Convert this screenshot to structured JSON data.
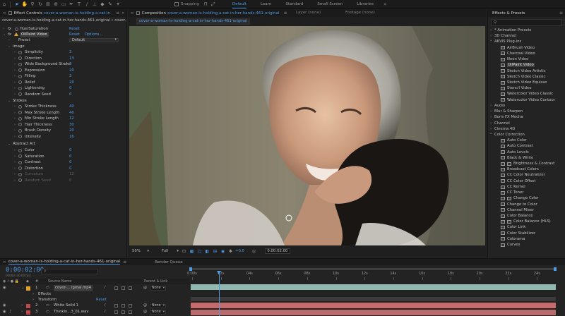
{
  "toolbar": {
    "snapping": "Snapping",
    "workspaces": [
      "Default",
      "Learn",
      "Standard",
      "Small Screen",
      "Libraries"
    ],
    "active_workspace": "Default"
  },
  "effect_controls": {
    "tab_label": "Effect Controls",
    "tab_file": "cover-a-woman-is-holding-a-cat-in-",
    "source": "cover-a-woman-is-holding-a-cat-in-her-hands-461-original",
    "source_b": "cover-a-woman-is-holdi",
    "effects": [
      {
        "name": "Hue/Saturation",
        "reset": "Reset"
      },
      {
        "name": "OilPaint Video",
        "reset": "Reset",
        "options": "Options..."
      }
    ],
    "preset_label": "Preset",
    "preset_value": "Default",
    "groups": {
      "image": "Image",
      "strokes": "Strokes",
      "abstract": "Abstract Art"
    },
    "image_params": [
      {
        "label": "Simplicity",
        "value": "3"
      },
      {
        "label": "Direction",
        "value": "13"
      },
      {
        "label": "Wide Background Stroke",
        "value": "3"
      },
      {
        "label": "Expression",
        "value": "20"
      },
      {
        "label": "Filling",
        "value": "3"
      },
      {
        "label": "Relief",
        "value": "20"
      },
      {
        "label": "Lightening",
        "value": "0"
      },
      {
        "label": "Random Seed",
        "value": "0"
      }
    ],
    "stroke_params": [
      {
        "label": "Stroke Thickness",
        "value": "40"
      },
      {
        "label": "Max Stroke Length",
        "value": "40"
      },
      {
        "label": "Min Stroke Length",
        "value": "12"
      },
      {
        "label": "Hair Thickness",
        "value": "30"
      },
      {
        "label": "Brush Density",
        "value": "20"
      },
      {
        "label": "Intensity",
        "value": "16"
      }
    ],
    "abstract_params": [
      {
        "label": "Color",
        "value": "0"
      },
      {
        "label": "Saturation",
        "value": "0"
      },
      {
        "label": "Contrast",
        "value": "0"
      },
      {
        "label": "Distortion",
        "value": "0"
      },
      {
        "label": "Curvature",
        "value": "12"
      },
      {
        "label": "Random Seed",
        "value": "0"
      }
    ]
  },
  "composition": {
    "tab_prefix": "Composition",
    "tab_name": "cover-a-woman-is-holding-a-cat-in-her-hands-461-original",
    "sub_tab": "cover-a-woman-is-holding-a-cat-in-her-hands-461-original",
    "layer_label": "Layer (none)",
    "footage_label": "Footage (none)",
    "zoom": "50%",
    "resolution": "Full",
    "exposure": "+0.0",
    "current_time": "0:00:02:00"
  },
  "effects_presets": {
    "title": "Effects & Presets",
    "items": [
      {
        "text": "* Animation Presets",
        "kind": "cat"
      },
      {
        "text": "3D Channel",
        "kind": "cat"
      },
      {
        "text": "AKVIS Plug-ins",
        "kind": "open"
      },
      {
        "text": "AirBrush Video",
        "kind": "child"
      },
      {
        "text": "Charcoal Video",
        "kind": "child"
      },
      {
        "text": "Neon Video",
        "kind": "child"
      },
      {
        "text": "OilPaint Video",
        "kind": "child",
        "selected": true
      },
      {
        "text": "Sketch Video Artistic",
        "kind": "child"
      },
      {
        "text": "Sketch Video Classic",
        "kind": "child"
      },
      {
        "text": "Sketch Video Equisse",
        "kind": "child"
      },
      {
        "text": "Stencil Video",
        "kind": "child"
      },
      {
        "text": "Watercolor Video Classic",
        "kind": "child"
      },
      {
        "text": "Watercolor Video Contour",
        "kind": "child"
      },
      {
        "text": "Audio",
        "kind": "cat"
      },
      {
        "text": "Blur & Sharpen",
        "kind": "cat"
      },
      {
        "text": "Boris FX Mocha",
        "kind": "cat"
      },
      {
        "text": "Channel",
        "kind": "cat"
      },
      {
        "text": "Cinema 4D",
        "kind": "cat"
      },
      {
        "text": "Color Correction",
        "kind": "open"
      },
      {
        "text": "Auto Color",
        "kind": "child"
      },
      {
        "text": "Auto Contrast",
        "kind": "child"
      },
      {
        "text": "Auto Levels",
        "kind": "child"
      },
      {
        "text": "Black & White",
        "kind": "child"
      },
      {
        "text": "Brightness & Contrast",
        "kind": "child2"
      },
      {
        "text": "Broadcast Colors",
        "kind": "child"
      },
      {
        "text": "CC Color Neutralizer",
        "kind": "child"
      },
      {
        "text": "CC Color Offset",
        "kind": "child"
      },
      {
        "text": "CC Kernel",
        "kind": "child"
      },
      {
        "text": "CC Toner",
        "kind": "child"
      },
      {
        "text": "Change Color",
        "kind": "child2"
      },
      {
        "text": "Change to Color",
        "kind": "child"
      },
      {
        "text": "Channel Mixer",
        "kind": "child"
      },
      {
        "text": "Color Balance",
        "kind": "child"
      },
      {
        "text": "Color Balance (HLS)",
        "kind": "child2"
      },
      {
        "text": "Color Link",
        "kind": "child"
      },
      {
        "text": "Color Stabilizer",
        "kind": "child"
      },
      {
        "text": "Colorama",
        "kind": "child"
      },
      {
        "text": "Curves",
        "kind": "child"
      }
    ]
  },
  "timeline": {
    "tab_name": "cover-a-woman-is-holding-a-cat-in-her-hands-461-original",
    "render_queue": "Render Queue",
    "timecode": "0:00:02:00",
    "fps": "00060 (30.00 fps)",
    "headers": {
      "source": "Source Name",
      "parent": "Parent & Link"
    },
    "ruler": [
      "0:00s",
      "02s",
      "04s",
      "06s",
      "08s",
      "10s",
      "12s",
      "14s",
      "16s",
      "18s",
      "20s",
      "22s",
      "24s"
    ],
    "layers": [
      {
        "num": "1",
        "name": "cover-... iginal.mp4",
        "parent": "None",
        "color": "#e0a229"
      },
      {
        "num": "2",
        "name": "White Solid 1",
        "parent": "None",
        "color": "#c04848"
      },
      {
        "num": "3",
        "name": "Thinkin...3_01.wav",
        "parent": "None",
        "color": "#c04848"
      }
    ],
    "sub": {
      "effects": "Effects",
      "transform": "Transform",
      "reset": "Reset"
    }
  }
}
